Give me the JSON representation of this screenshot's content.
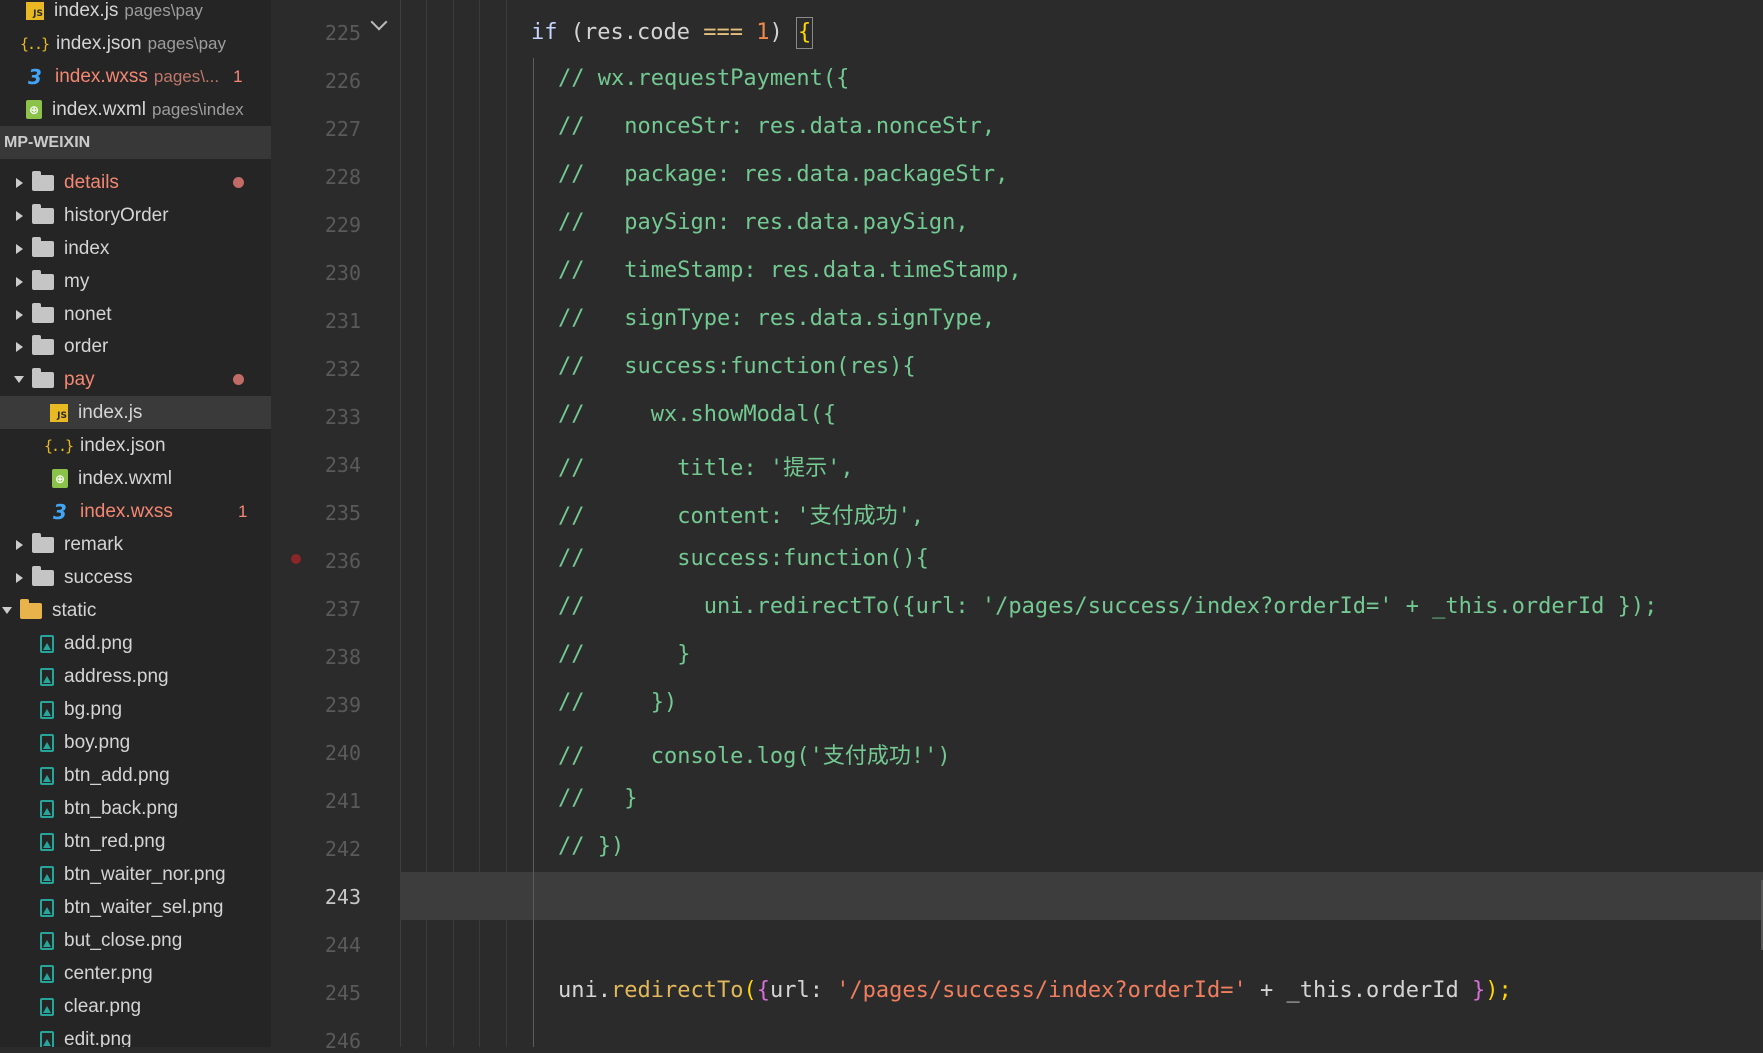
{
  "open_editors": [
    {
      "name": "index.js",
      "desc": "pages\\pay",
      "icon": "js-icon"
    },
    {
      "name": "index.json",
      "desc": "pages\\pay",
      "icon": "json-icon"
    },
    {
      "name": "index.wxss",
      "desc": "pages\\...",
      "icon": "css-icon",
      "problems": "1",
      "modified": true
    },
    {
      "name": "index.wxml",
      "desc": "pages\\index",
      "icon": "wxml-icon"
    }
  ],
  "explorer": {
    "title": "MP-WEIXIN",
    "folders_pages": [
      "details",
      "historyOrder",
      "index",
      "my",
      "nonet",
      "order",
      "pay"
    ],
    "pay_files": [
      "index.js",
      "index.json",
      "index.wxml",
      "index.wxss"
    ],
    "pay_wxss_problems": "1",
    "folders_after": [
      "remark",
      "success"
    ],
    "static_folder": "static",
    "static_files": [
      "add.png",
      "address.png",
      "bg.png",
      "boy.png",
      "btn_add.png",
      "btn_back.png",
      "btn_red.png",
      "btn_waiter_nor.png",
      "btn_waiter_sel.png",
      "but_close.png",
      "center.png",
      "clear.png",
      "edit.png"
    ]
  },
  "gutter": {
    "line_numbers": [
      "225",
      "226",
      "227",
      "228",
      "229",
      "230",
      "231",
      "232",
      "233",
      "234",
      "235",
      "236",
      "237",
      "238",
      "239",
      "240",
      "241",
      "242",
      "243",
      "244",
      "245",
      "246"
    ],
    "current_line": "243",
    "breakpoint_line": "236"
  },
  "code": {
    "l225_if": "if",
    "l225_paren_open": " (",
    "l225_expr": "res.code",
    "l225_op": " === ",
    "l225_num": "1",
    "l225_paren_close": ") ",
    "l225_brace": "{",
    "comments": [
      "// wx.requestPayment({",
      "//   nonceStr: res.data.nonceStr,",
      "//   package: res.data.packageStr,",
      "//   paySign: res.data.paySign,",
      "//   timeStamp: res.data.timeStamp,",
      "//   signType: res.data.signType,",
      "//   success:function(res){",
      "//     wx.showModal({",
      "//       title: '提示',",
      "//       content: '支付成功',",
      "//       success:function(){",
      "//         uni.redirectTo({url: '/pages/success/index?orderId=' + _this.orderId });",
      "//       }",
      "//     })",
      "//     console.log('支付成功!')",
      "//   }",
      "// })"
    ],
    "l245_obj": "uni",
    "l245_dot": ".",
    "l245_fn": "redirectTo",
    "l245_paren": "(",
    "l245_brace_open": "{",
    "l245_key": "url: ",
    "l245_str": "'/pages/success/index?orderId='",
    "l245_plus": " + ",
    "l245_rest": "_this.orderId ",
    "l245_brace_close": "}",
    "l245_end": ");"
  }
}
